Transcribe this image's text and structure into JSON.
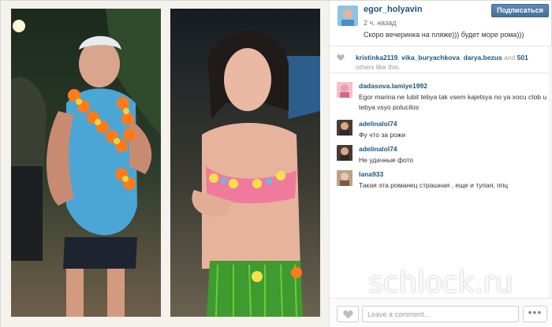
{
  "header": {
    "username": "egor_holyavin",
    "timestamp": "2 ч. назад",
    "caption": "Скоро вечеринка на пляже))) будет море рома)))",
    "follow_label": "Подписаться"
  },
  "likes": {
    "users": [
      "kristinka2119",
      "vika_buryachkova",
      "darya.bezus"
    ],
    "and_label": "and",
    "count": "501",
    "suffix": "others like this."
  },
  "comments": [
    {
      "username": "dadasova.lamiye1992",
      "text": "Egor marina ne lubit tebya tak vsem kajetsya no ya xocu ctob u tebya vsyo polucilos"
    },
    {
      "username": "adelinalol74",
      "text": "Фу что за рожи"
    },
    {
      "username": "adelinalol74",
      "text": "Не удачные фото"
    },
    {
      "username": "lana933",
      "text": "Такая эта романец страшная , еще и тупая, ппц"
    }
  ],
  "footer": {
    "comment_placeholder": "Leave a comment...",
    "more_label": "•••"
  },
  "watermark": "schlock.ru",
  "icons": {
    "heart": "heart-icon",
    "more": "ellipsis-icon"
  },
  "colors": {
    "username": "#1c5380",
    "follow_button": "#4f7cab"
  }
}
